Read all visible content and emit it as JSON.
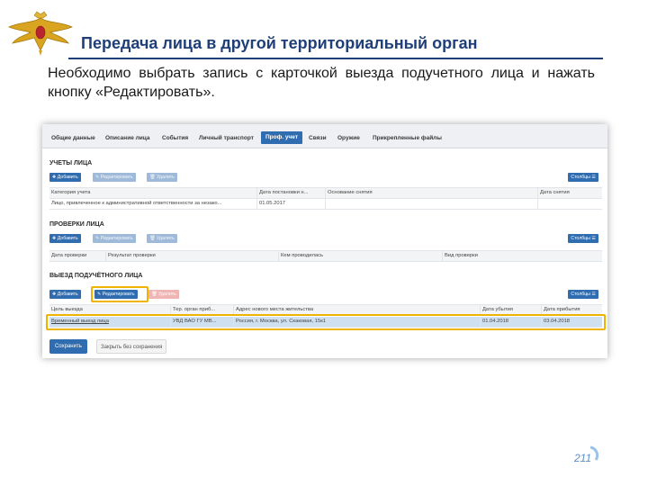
{
  "slide": {
    "title": "Передача лица в другой территориальный орган",
    "text": "Необходимо выбрать запись с карточкой выезда подучетного лица и нажать кнопку «Редактировать».",
    "page_number": "211"
  },
  "tabs": [
    "Общие данные",
    "Описание лица",
    "События",
    "Личный транспорт",
    "Проф. учет",
    "Связи",
    "Оружие",
    "Прикрепленные файлы"
  ],
  "active_tab": "Проф. учет",
  "buttons": {
    "add": "Добавить",
    "edit": "Редактировать",
    "delete": "Удалить",
    "columns": "Столбцы",
    "save": "Сохранить",
    "close": "Закрыть без сохранения"
  },
  "section1": {
    "title": "УЧЕТЫ ЛИЦА",
    "headers": [
      "Категория учета",
      "Дата постановки н...",
      "Основание снятия",
      "Дата снятия"
    ],
    "row": [
      "Лицо, привлеченное к административной ответственности за незако...",
      "01.05.2017",
      "",
      ""
    ]
  },
  "section2": {
    "title": "ПРОВЕРКИ ЛИЦА",
    "headers": [
      "Дата проверки",
      "Результат проверки",
      "Кем проводилась",
      "Вид проверки"
    ]
  },
  "section3": {
    "title": "ВЫЕЗД ПОДУЧЁТНОГО ЛИЦА",
    "headers": [
      "Цель выезда",
      "Тер. орган приб...",
      "Адрес нового места жительства",
      "Дата убытия",
      "Дата прибытия"
    ],
    "row": [
      "Временный выезд лица",
      "УВД ВАО ГУ МВ...",
      "Россия, г. Москва, ул. Скаковая, 15к1",
      "01.04.2018",
      "03.04.2018"
    ]
  },
  "colors": {
    "accent": "#2f6cb0",
    "highlight": "#f0b400",
    "title": "#1f3f78"
  }
}
